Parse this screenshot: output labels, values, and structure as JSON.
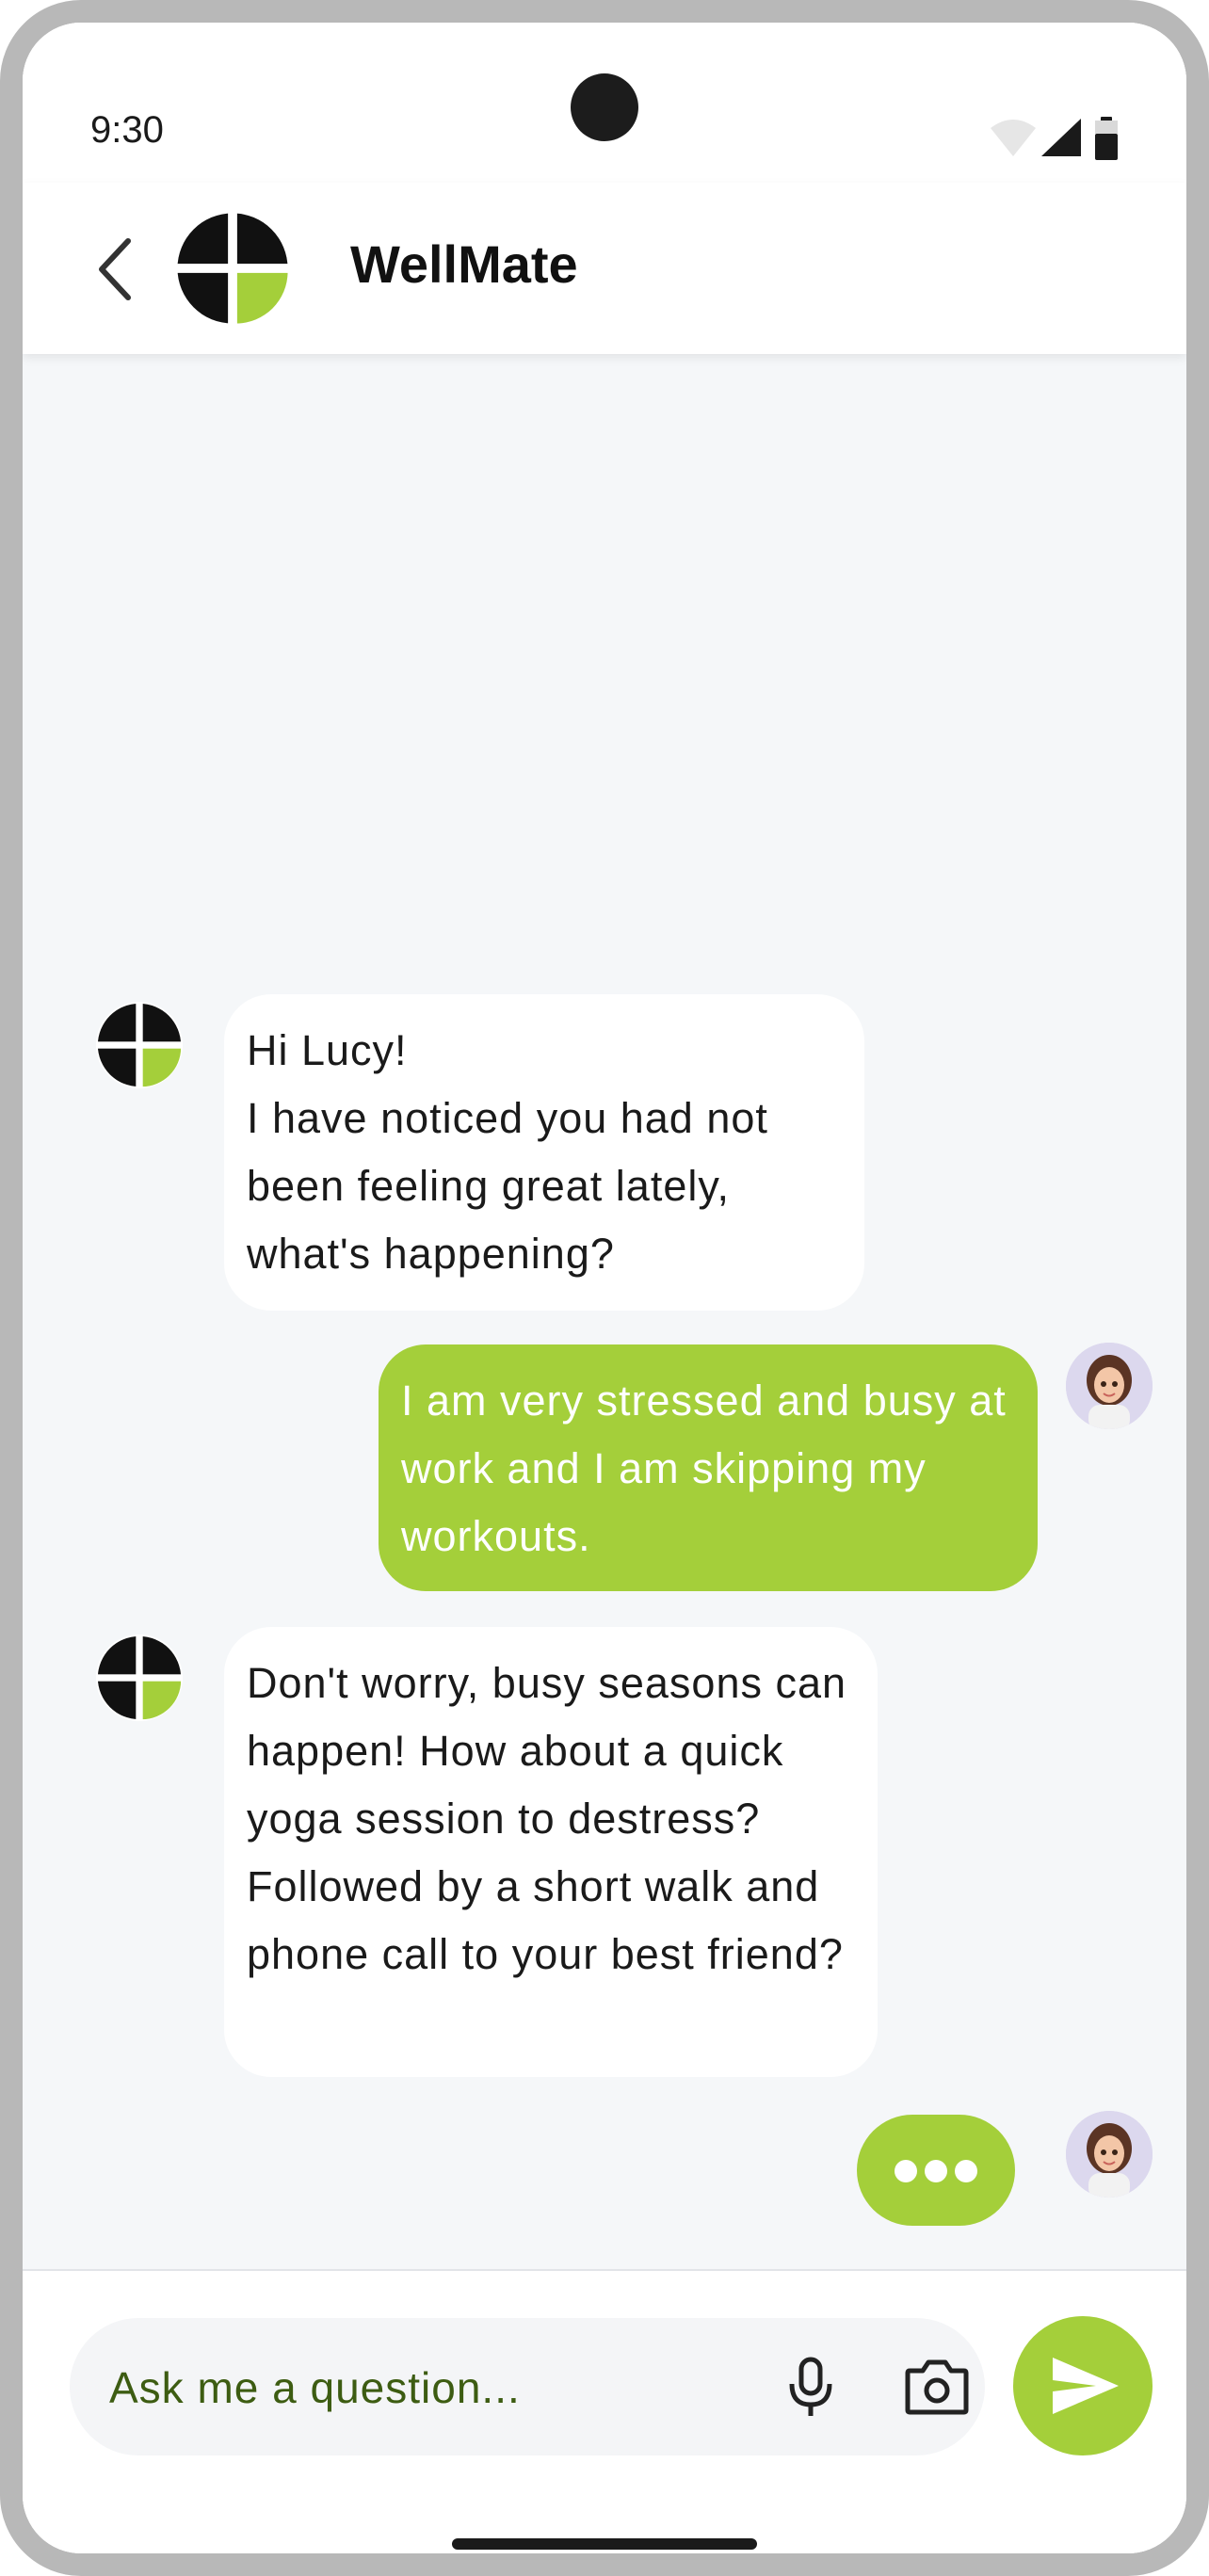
{
  "status_bar": {
    "time": "9:30",
    "icons": [
      "wifi-icon",
      "signal-icon",
      "battery-icon"
    ]
  },
  "header": {
    "title": "WellMate",
    "back_icon": "chevron-left-icon",
    "logo": "wellmate-logo"
  },
  "messages": [
    {
      "sender": "bot",
      "text": "Hi Lucy!\nI have noticed you had not been feeling great lately, what's happening?"
    },
    {
      "sender": "user",
      "text": "I am very stressed and busy at work and I am skipping my workouts."
    },
    {
      "sender": "bot",
      "text": "Don't worry, busy seasons can happen! How about a quick yoga session to destress? Followed by a short walk and phone call to your best friend?"
    }
  ],
  "typing_indicator": {
    "sender": "user",
    "state": "typing"
  },
  "composer": {
    "placeholder": "Ask me a question...",
    "icons": [
      "microphone-icon",
      "camera-icon",
      "send-icon"
    ]
  },
  "colors": {
    "accent": "#a4cf3a",
    "chat_background": "#f5f7f9",
    "placeholder_text": "#3d5c12"
  }
}
